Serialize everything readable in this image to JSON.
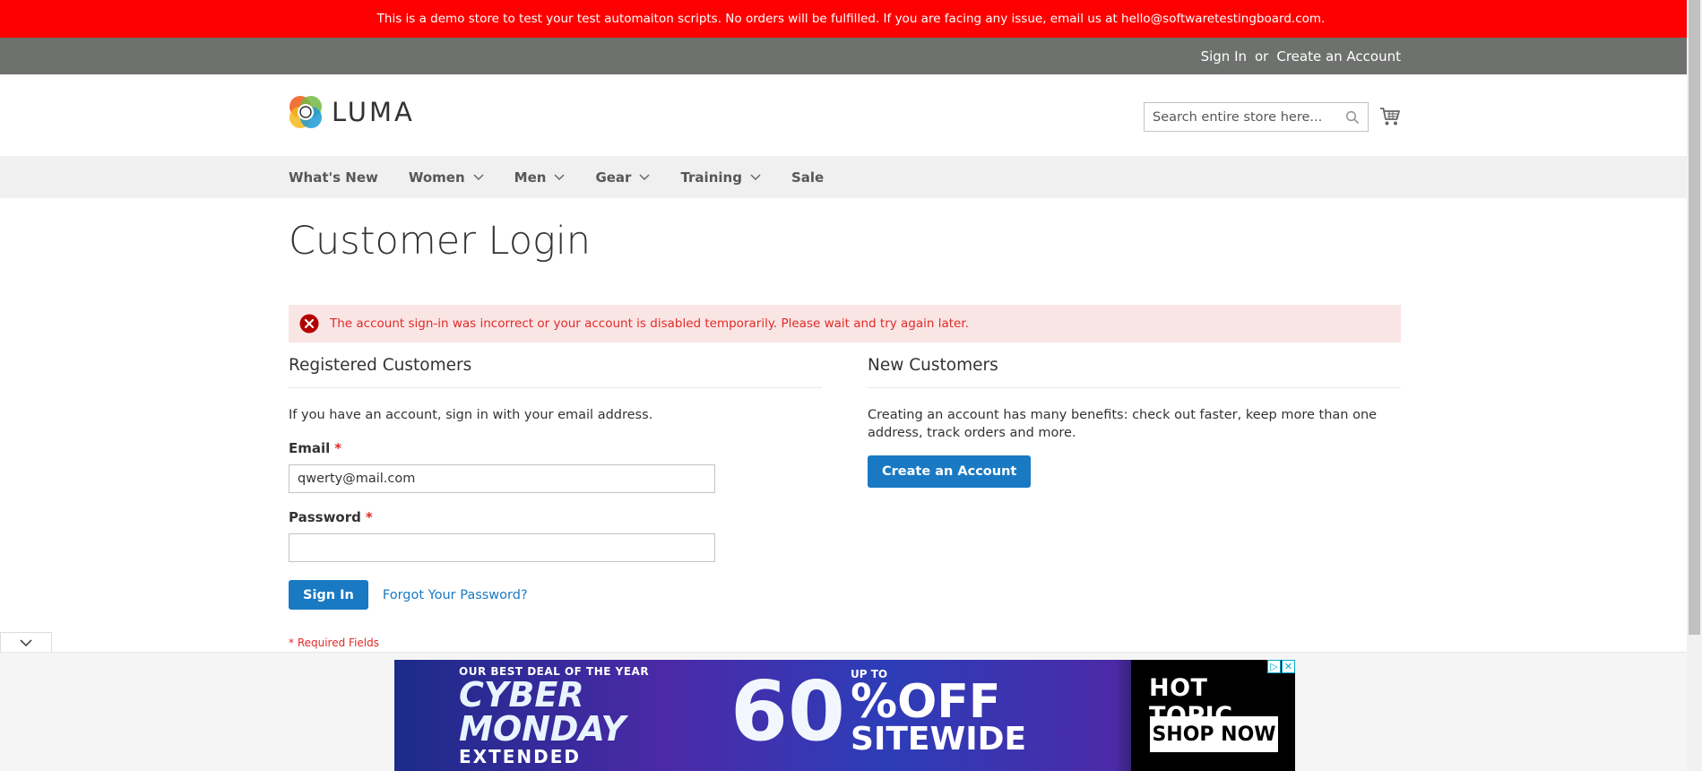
{
  "demo_notice": "This is a demo store to test your test automaiton scripts. No orders will be fulfilled. If you are facing any issue, email us at hello@softwaretestingboard.com.",
  "header_links": {
    "sign_in": "Sign In",
    "or": "or",
    "create_account": "Create an Account"
  },
  "logo": {
    "text": "LUMA"
  },
  "search": {
    "placeholder": "Search entire store here..."
  },
  "nav": {
    "items": [
      {
        "label": "What's New",
        "dropdown": false
      },
      {
        "label": "Women",
        "dropdown": true
      },
      {
        "label": "Men",
        "dropdown": true
      },
      {
        "label": "Gear",
        "dropdown": true
      },
      {
        "label": "Training",
        "dropdown": true
      },
      {
        "label": "Sale",
        "dropdown": false
      }
    ]
  },
  "page_title": "Customer Login",
  "error_message": "The account sign-in was incorrect or your account is disabled temporarily. Please wait and try again later.",
  "registered": {
    "title": "Registered Customers",
    "intro": "If you have an account, sign in with your email address.",
    "email_label": "Email",
    "email_value": "qwerty@mail.com",
    "password_label": "Password",
    "password_value": "",
    "required_mark": "*",
    "sign_in_button": "Sign In",
    "forgot_link": "Forgot Your Password?",
    "required_note": "* Required Fields"
  },
  "new_customers": {
    "title": "New Customers",
    "intro": "Creating an account has many benefits: check out faster, keep more than one address, track orders and more.",
    "create_button": "Create an Account"
  },
  "ad": {
    "deal_line": "OUR BEST DEAL OF THE YEAR",
    "cyber": "CYBER",
    "monday": "MONDAY",
    "extended": "EXTENDED",
    "up_to": "UP TO",
    "percent": "60",
    "off": "%OFF",
    "sitewide": "SITEWIDE",
    "brand": "HOT TOPIC",
    "cta": "SHOP NOW"
  },
  "colors": {
    "demo_bar": "#ff0000",
    "accent": "#1979c3",
    "error_text": "#e02b27",
    "error_bg": "#fae5e5"
  }
}
